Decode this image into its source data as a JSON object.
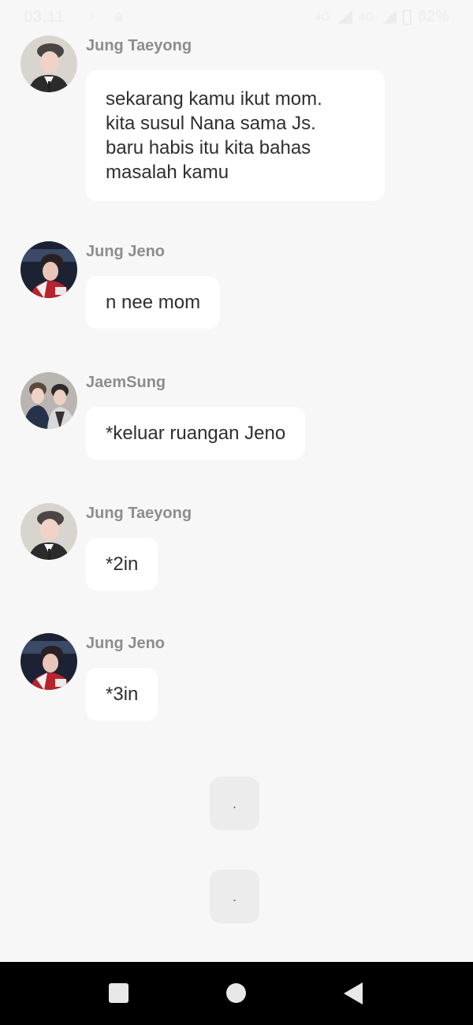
{
  "status_bar": {
    "time": "03.11",
    "network_1": "4G",
    "network_2": "4G",
    "battery": "62%",
    "icons": [
      "music-note-icon",
      "lock-icon",
      "signal-icon",
      "battery-icon"
    ]
  },
  "messages": [
    {
      "sender": "Jung Taeyong",
      "text": "sekarang kamu ikut mom.\nkita susul Nana sama Js.\nbaru habis itu kita bahas\nmasalah kamu"
    },
    {
      "sender": "Jung Jeno",
      "text": "n nee mom"
    },
    {
      "sender": "JaemSung",
      "text": "*keluar ruangan Jeno"
    },
    {
      "sender": "Jung Taeyong",
      "text": "*2in"
    },
    {
      "sender": "Jung Jeno",
      "text": "*3in"
    }
  ],
  "system_bubbles": [
    ".",
    "."
  ],
  "nav": {
    "icons": [
      "recents-square-icon",
      "home-circle-icon",
      "back-triangle-icon"
    ]
  },
  "colors": {
    "background": "#f7f7f7",
    "bubble": "#ffffff",
    "sender": "#8d8d8d",
    "nav": "#000000"
  }
}
